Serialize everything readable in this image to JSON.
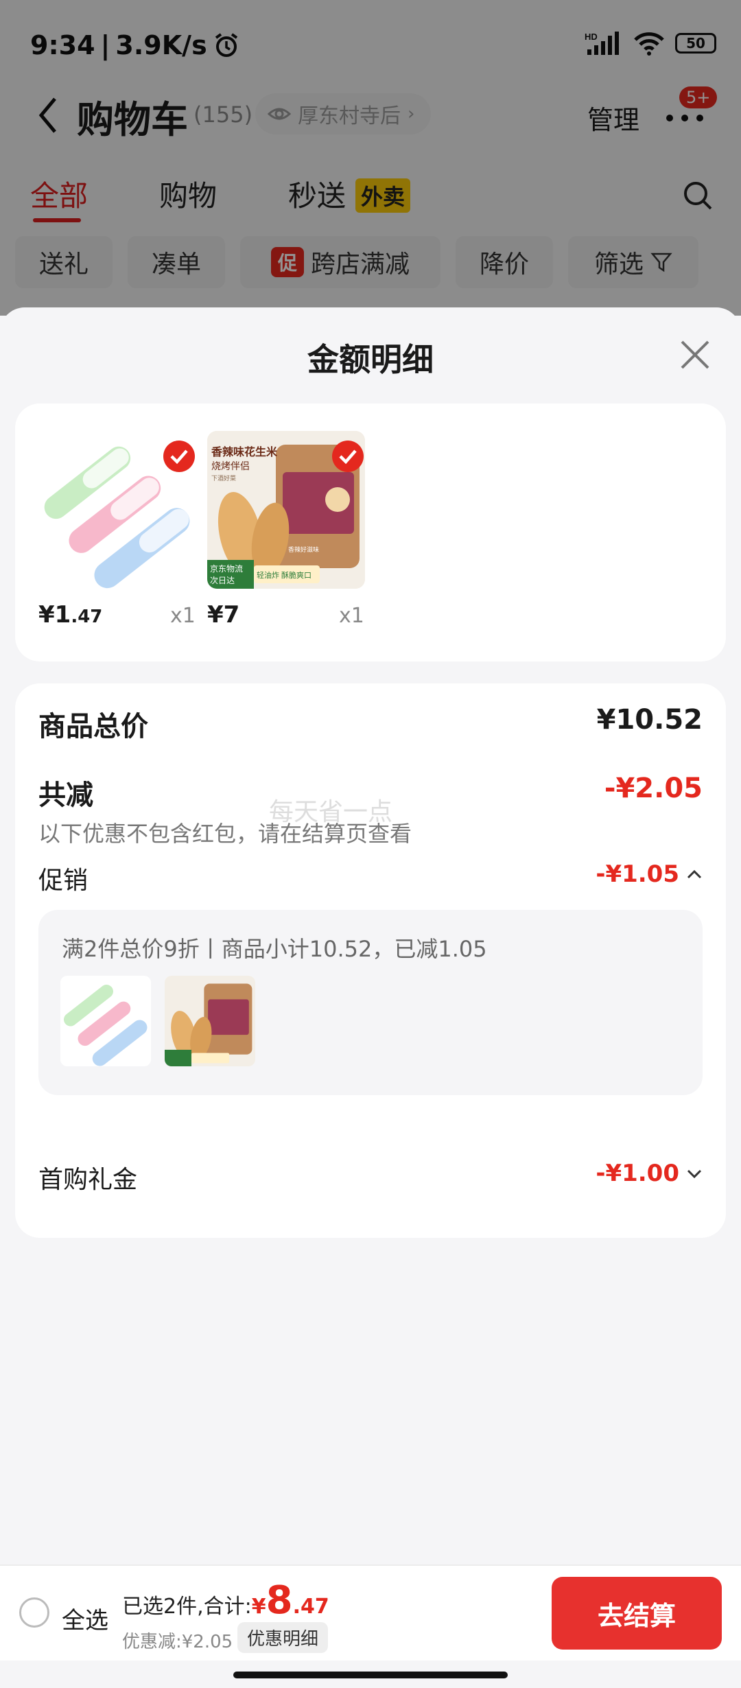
{
  "status_bar": {
    "time": "9:34",
    "speed": "3.9K/s",
    "network": "HD",
    "wifi_sub": "6",
    "battery": "50"
  },
  "header": {
    "title": "购物车",
    "count": "(155)",
    "location": "厚东村寺后",
    "manage": "管理",
    "badge": "5+"
  },
  "tabs": [
    {
      "label": "全部"
    },
    {
      "label": "购物"
    },
    {
      "label": "秒送"
    }
  ],
  "tab_badge": "外卖",
  "chips": [
    {
      "label": "送礼"
    },
    {
      "label": "凑单"
    },
    {
      "label": "跨店满减",
      "tag": "促"
    },
    {
      "label": "降价"
    },
    {
      "label": "筛选"
    }
  ],
  "sheet": {
    "title": "金额明细"
  },
  "products": [
    {
      "price_int": "¥1",
      "price_dec": ".47",
      "qty": "x1"
    },
    {
      "price_int": "¥7",
      "price_dec": "",
      "qty": "x1",
      "img_title": "香辣味花生米",
      "img_sub": "烧烤伴侣",
      "img_small": "下酒好菜",
      "img_tag1": "京东物流",
      "img_tag2": "次日达",
      "img_tag3": "轻油炸 酥脆爽口",
      "img_jar": "香辣好滋味"
    }
  ],
  "summary": {
    "total_label": "商品总价",
    "total_value": "¥10.52",
    "reduce_label": "共减",
    "reduce_value": "-¥2.05",
    "reduce_note": "以下优惠不包含红包，请在结算页查看",
    "watermark": "每天省一点",
    "promo_label": "促销",
    "promo_value": "-¥1.05",
    "promo_detail": "满2件总价9折丨商品小计10.52，已减1.05",
    "first_label": "首购礼金",
    "first_value": "-¥1.00"
  },
  "bottom": {
    "select_all": "全选",
    "selected_text": "已选2件,合计:",
    "total_sym": "¥",
    "total_int": "8",
    "total_dec": ".47",
    "discount": "优惠减:¥2.05",
    "detail_button": "优惠明细",
    "checkout": "去结算"
  },
  "colors": {
    "accent": "#e4281e",
    "checkout": "#e7312e",
    "badge_yellow": "#f8c80c"
  }
}
